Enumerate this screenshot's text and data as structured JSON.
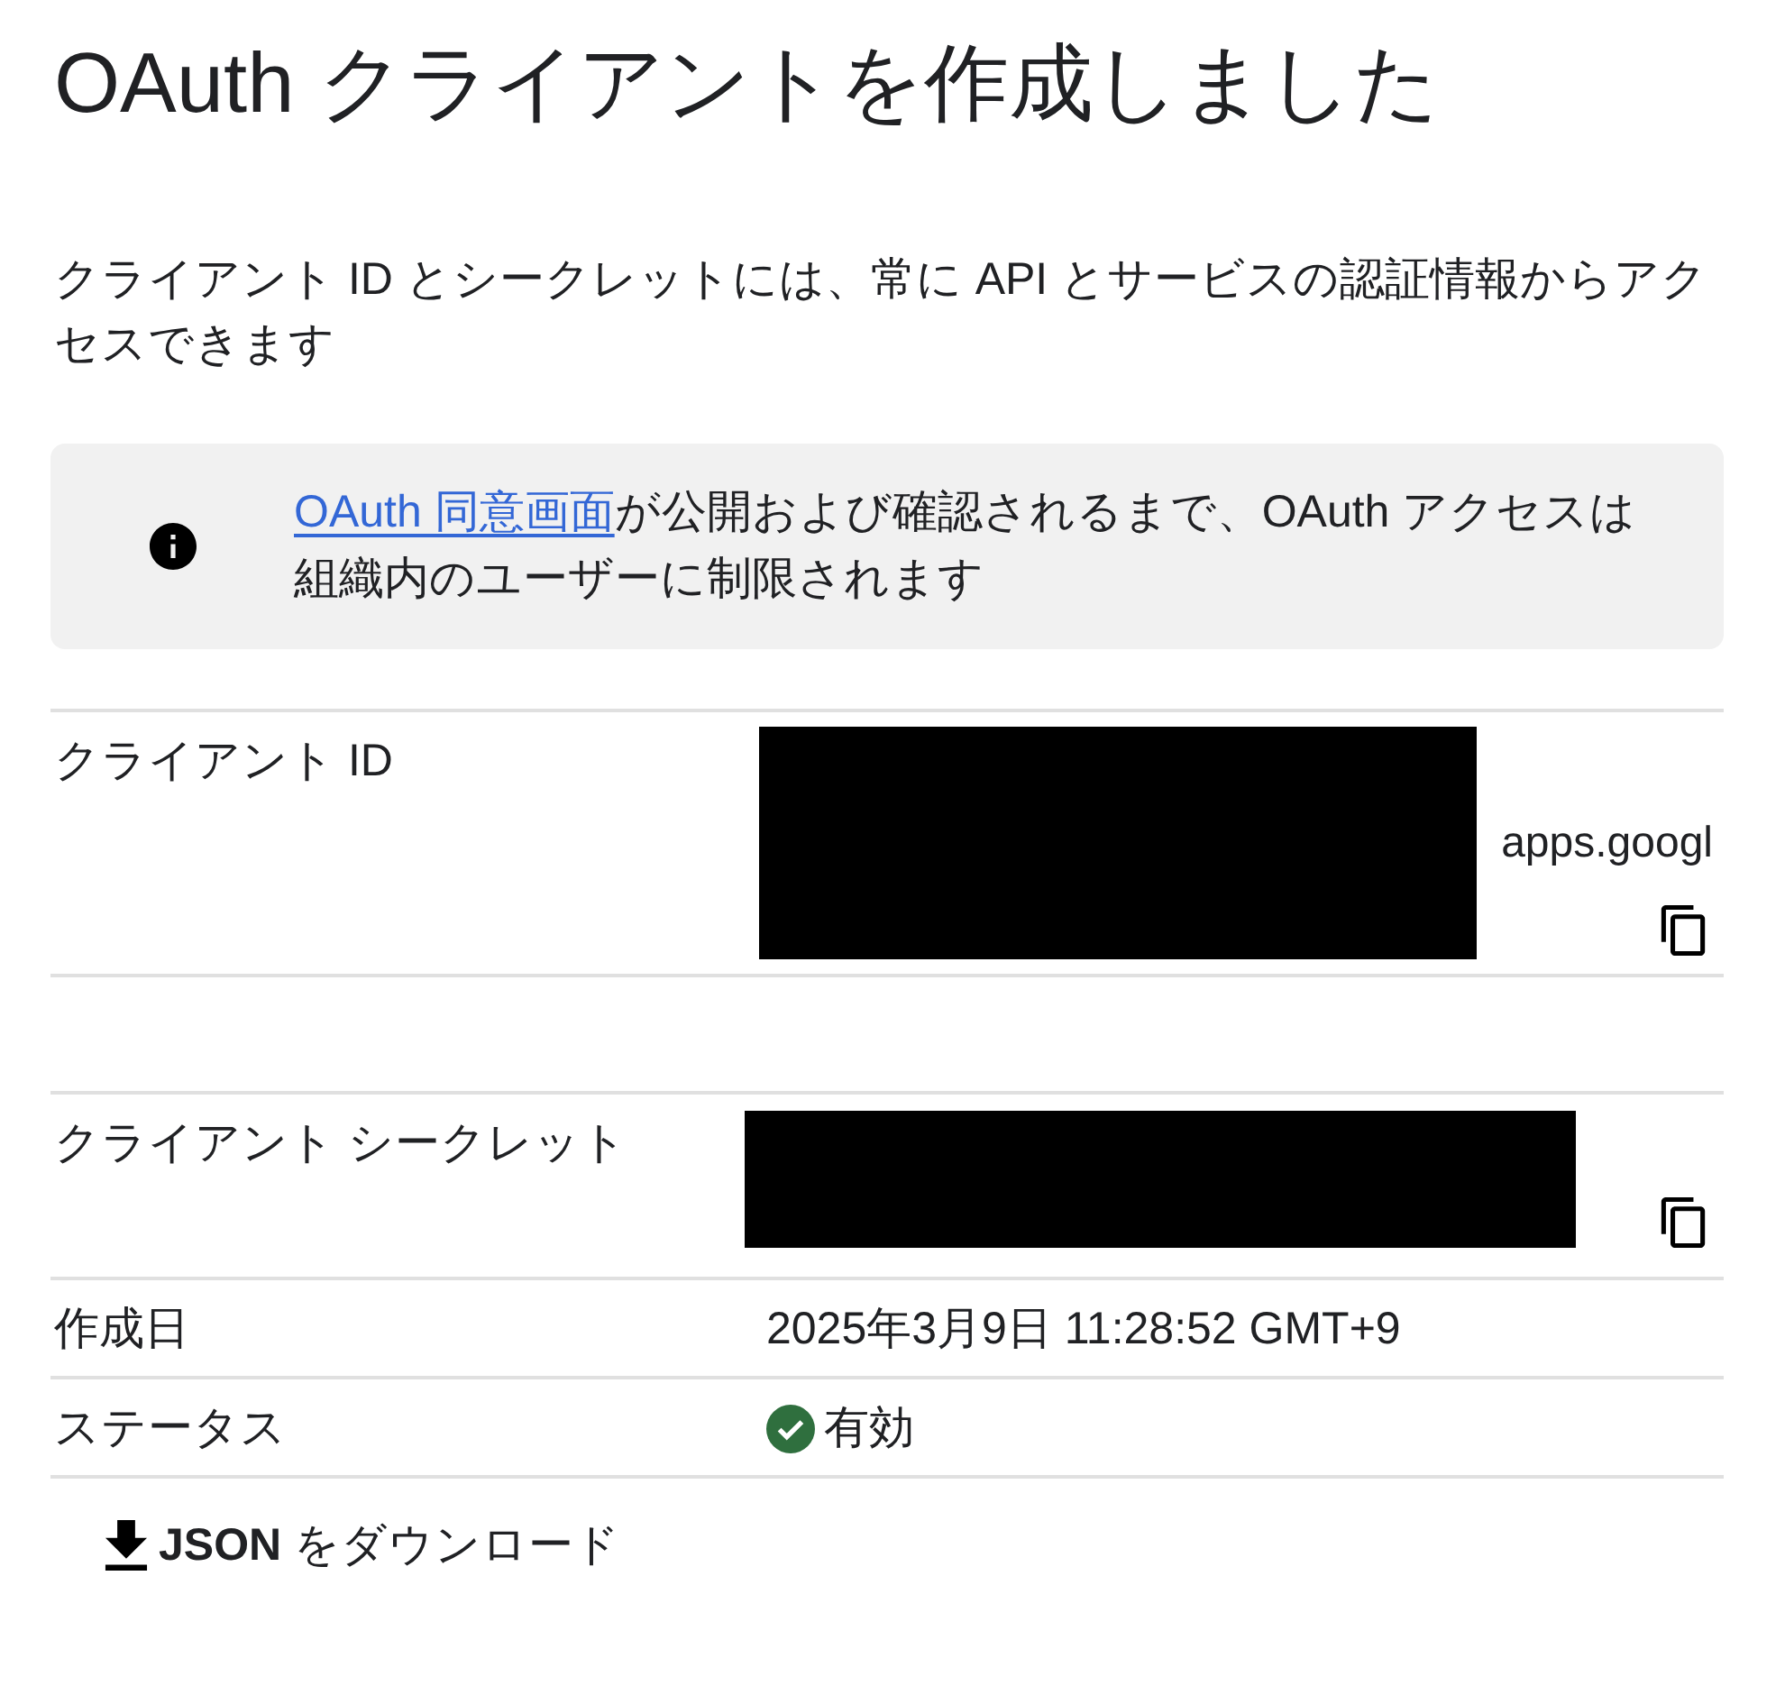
{
  "title": "OAuth クライアントを作成しました",
  "description": "クライアント ID とシークレットには、常に API とサービスの認証情報からアクセスできます",
  "notice": {
    "link": "OAuth 同意画面",
    "text": "が公開および確認されるまで、OAuth アクセスは組織内のユーザーに制限されます"
  },
  "details": [
    {
      "kind": "identifier",
      "label": "クライアント ID",
      "visible_tail": "apps.googl"
    },
    {
      "kind": "blank"
    },
    {
      "kind": "secret",
      "label": "クライアント シークレット"
    },
    {
      "kind": "text",
      "label": "作成日",
      "value": "2025年3月9日 11:28:52 GMT+9"
    },
    {
      "kind": "status",
      "label": "ステータス",
      "value": "有効",
      "enabled": true
    }
  ],
  "download_button": {
    "label": "**JSON** をダウンロード"
  }
}
